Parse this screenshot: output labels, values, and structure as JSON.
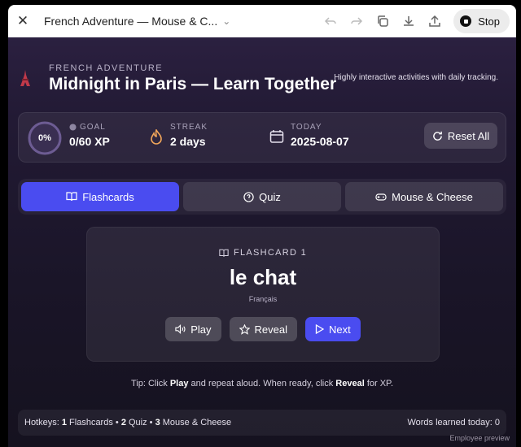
{
  "window": {
    "tab_title": "French Adventure — Mouse & C...",
    "stop_label": "Stop"
  },
  "hero": {
    "kicker": "FRENCH ADVENTURE",
    "title": "Midnight in Paris — Learn Together",
    "tagline": "Highly interactive activities with daily tracking."
  },
  "stats": {
    "progress_label": "0%",
    "progress_fraction": 0,
    "goal_label": "GOAL",
    "goal_value": "0/60 XP",
    "streak_label": "STREAK",
    "streak_value": "2 days",
    "today_label": "TODAY",
    "today_value": "2025-08-07",
    "reset_label": "Reset All"
  },
  "tabs": [
    {
      "label": "Flashcards",
      "icon": "book-icon",
      "active": true
    },
    {
      "label": "Quiz",
      "icon": "quiz-icon",
      "active": false
    },
    {
      "label": "Mouse & Cheese",
      "icon": "gamepad-icon",
      "active": false
    }
  ],
  "flashcard": {
    "header": "FLASHCARD 1",
    "word": "le chat",
    "language": "Français",
    "play_label": "Play",
    "reveal_label": "Reveal",
    "next_label": "Next"
  },
  "tip": {
    "prefix": "Tip: Click ",
    "play": "Play",
    "middle": " and repeat aloud. When ready, click ",
    "reveal": "Reveal",
    "suffix": " for XP."
  },
  "footer": {
    "hotkeys_label": "Hotkeys: ",
    "hk1_num": "1",
    "hk1_text": " Flashcards • ",
    "hk2_num": "2",
    "hk2_text": " Quiz • ",
    "hk3_num": "3",
    "hk3_text": " Mouse & Cheese",
    "words_learned": "Words learned today: 0"
  },
  "watermark": "Employee preview",
  "colors": {
    "accent": "#4a4cf0",
    "streak_flame": "#f2a65a"
  }
}
